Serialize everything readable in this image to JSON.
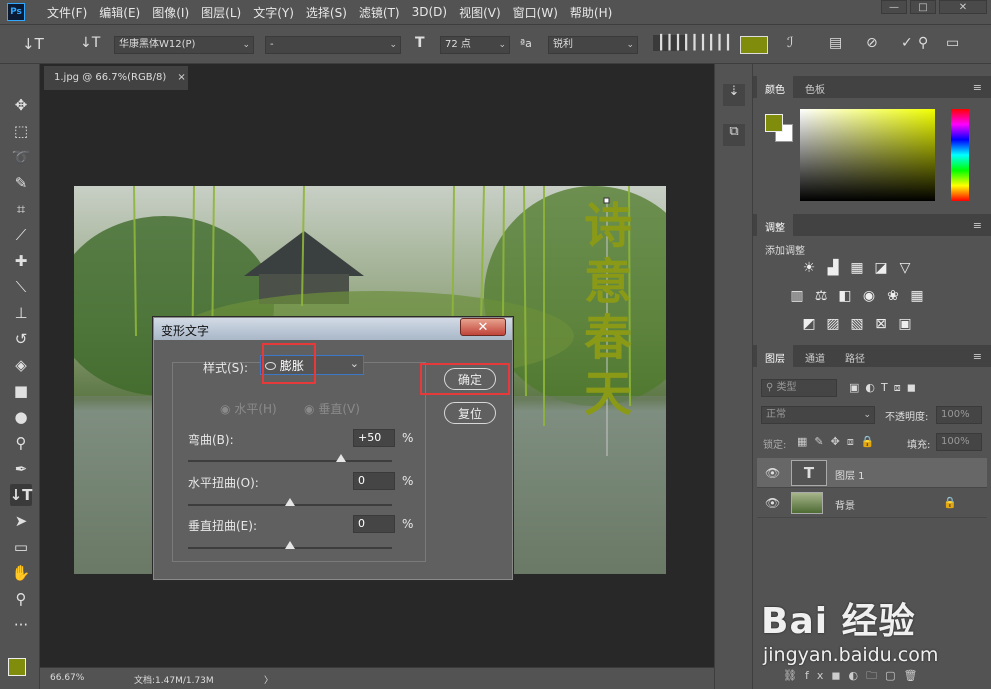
{
  "menubar": {
    "logo": "Ps",
    "items": [
      "文件(F)",
      "编辑(E)",
      "图像(I)",
      "图层(L)",
      "文字(Y)",
      "选择(S)",
      "滤镜(T)",
      "3D(D)",
      "视图(V)",
      "窗口(W)",
      "帮助(H)"
    ]
  },
  "options": {
    "font_family": "华康黑体W12(P)",
    "font_style": "-",
    "font_size": "72 点",
    "aa_label": "ªa",
    "antialias": "锐利",
    "text_color": "#7f8c0c"
  },
  "document": {
    "tab_title": "1.jpg @ 66.7%(RGB/8)",
    "tab_close": "×",
    "vertical_text": [
      "诗",
      "意",
      "春",
      "天"
    ],
    "text_color": "#8b9a16"
  },
  "status": {
    "zoom": "66.67%",
    "doc_info": "文档:1.47M/1.73M",
    "arrow": "〉"
  },
  "dialog": {
    "title": "变形文字",
    "close": "✕",
    "style_label": "样式(S):",
    "style_value": "膨胀",
    "horizontal": "水平(H)",
    "vertical": "垂直(V)",
    "bend_label": "弯曲(B):",
    "bend_value": "+50",
    "hdist_label": "水平扭曲(O):",
    "hdist_value": "0",
    "vdist_label": "垂直扭曲(E):",
    "vdist_value": "0",
    "percent": "%",
    "ok": "确定",
    "reset": "复位",
    "bend_level": 0.75,
    "hdist_level": 0.5,
    "vdist_level": 0.5
  },
  "color_panel": {
    "tabs": [
      "颜色",
      "色板"
    ],
    "foreground": "#7f8c0c",
    "background": "#ffffff",
    "hue": "#f1ff00"
  },
  "adjust_panel": {
    "title": "调整",
    "subtitle": "添加调整"
  },
  "layers_panel": {
    "tabs": [
      "图层",
      "通道",
      "路径"
    ],
    "filter": "类型",
    "blend_mode": "正常",
    "opacity_label": "不透明度:",
    "opacity": "100%",
    "lock_label": "锁定:",
    "fill_label": "填充:",
    "fill": "100%",
    "layers": [
      {
        "name": "图层 1",
        "type": "T"
      },
      {
        "name": "背景"
      }
    ]
  },
  "watermark": {
    "brand": "Bai 经验",
    "url": "jingyan.baidu.com"
  }
}
